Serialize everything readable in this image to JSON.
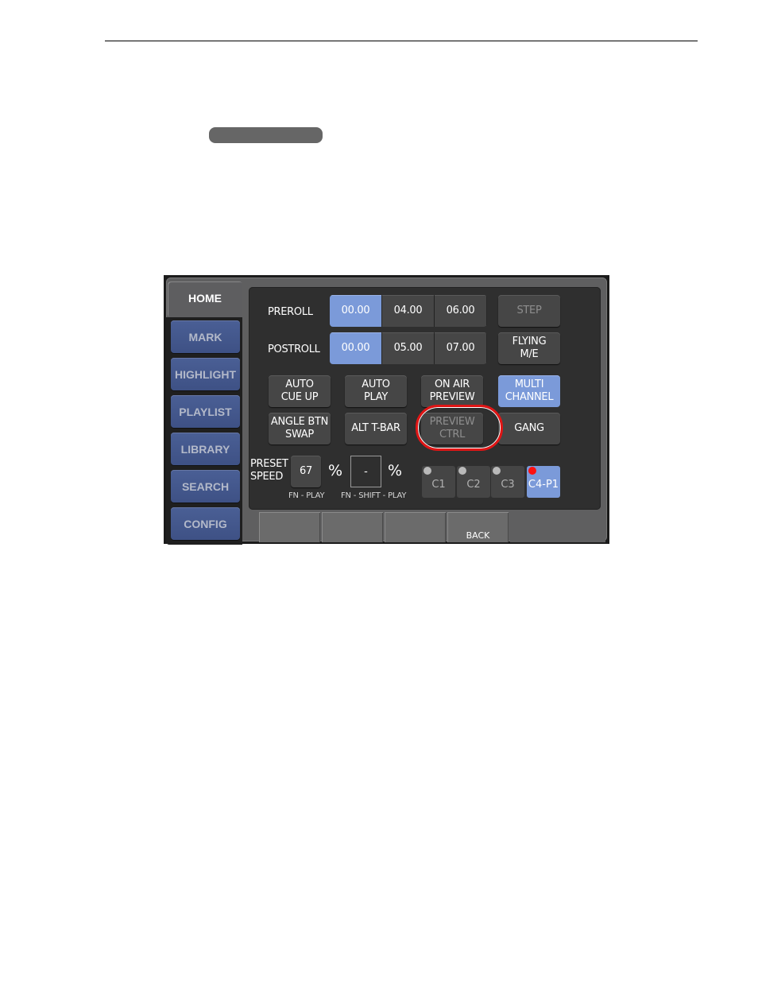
{
  "page": {
    "header_rule": true
  },
  "tabs": [
    {
      "label": "HOME",
      "active": true
    },
    {
      "label": "MARK"
    },
    {
      "label": "HIGHLIGHT"
    },
    {
      "label": "PLAYLIST"
    },
    {
      "label": "LIBRARY"
    },
    {
      "label": "SEARCH"
    },
    {
      "label": "CONFIG"
    }
  ],
  "preroll": {
    "label": "PREROLL",
    "options": [
      "00.00",
      "04.00",
      "06.00"
    ],
    "selected": "00.00"
  },
  "postroll": {
    "label": "POSTROLL",
    "options": [
      "00.00",
      "05.00",
      "07.00"
    ],
    "selected": "00.00"
  },
  "buttons": {
    "step": "STEP",
    "flying_me": "FLYING\nM/E",
    "auto_cue_up": "AUTO\nCUE UP",
    "auto_play": "AUTO\nPLAY",
    "on_air_preview": "ON AIR\nPREVIEW",
    "multi_channel": "MULTI\nCHANNEL",
    "angle_btn_swap": "ANGLE BTN\nSWAP",
    "alt_t_bar": "ALT T-BAR",
    "preview_ctrl": "PREVIEW\nCTRL",
    "gang": "GANG"
  },
  "preset_speed": {
    "label": "PRESET\nSPEED",
    "fn_play_value": "67",
    "fn_play_unit": "%",
    "fn_play_caption": "FN - PLAY",
    "fn_shift_play_value": "-",
    "fn_shift_play_unit": "%",
    "fn_shift_play_caption": "FN - SHIFT - PLAY"
  },
  "channels": [
    {
      "label": "C1",
      "indicator": "gray"
    },
    {
      "label": "C2",
      "indicator": "gray"
    },
    {
      "label": "C3",
      "indicator": "gray"
    },
    {
      "label": "C4-P1",
      "indicator": "red",
      "active": true
    }
  ],
  "softkeys": [
    "",
    "",
    "",
    "BACK",
    ""
  ],
  "colors": {
    "active_blue": "#7b9ad9",
    "tab_blue": "#44578c",
    "highlight_red": "#e01515",
    "indicator_red": "#ff1010"
  }
}
